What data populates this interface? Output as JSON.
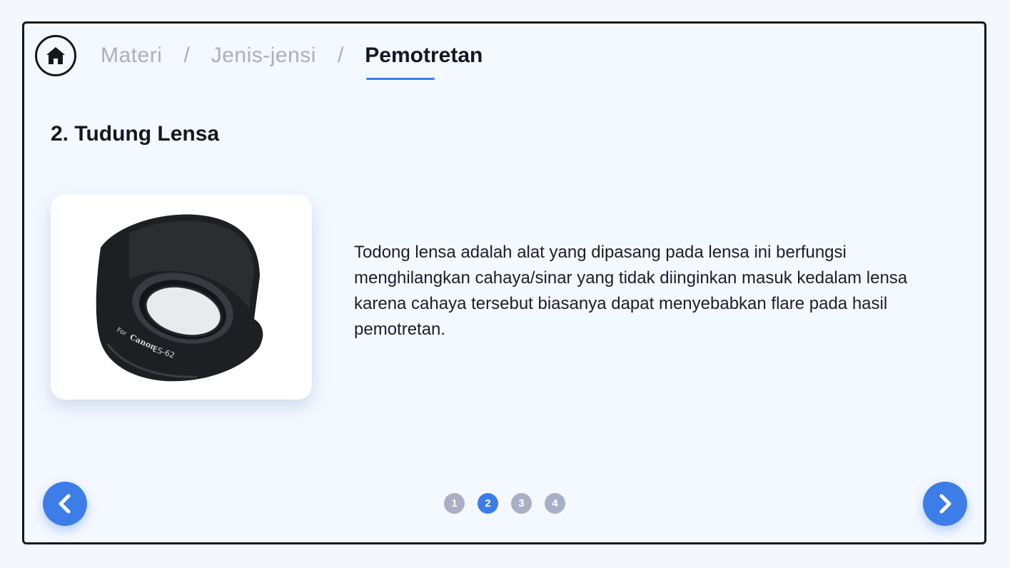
{
  "breadcrumb": {
    "items": [
      "Materi",
      "Jenis-jensi"
    ],
    "separator": "/",
    "current": "Pemotretan"
  },
  "section": {
    "title": "2. Tudung Lensa",
    "description": "Todong lensa adalah alat yang dipasang pada lensa ini berfungsi menghilangkan cahaya/sinar yang tidak diinginkan masuk kedalam lensa karena cahaya tersebut biasanya dapat menyebabkan flare pada hasil pemotretan.",
    "image": {
      "icon": "lens-hood-image",
      "printed_text": "For Canon ES-62"
    }
  },
  "pager": {
    "pages": [
      "1",
      "2",
      "3",
      "4"
    ],
    "active": "2"
  },
  "icons": {
    "home": "home-icon",
    "prev": "chevron-left-icon",
    "next": "chevron-right-icon"
  },
  "colors": {
    "accent": "#3d7de8",
    "inactive": "#a9afc4",
    "text": "#15171c",
    "background": "#f4f8ff"
  }
}
